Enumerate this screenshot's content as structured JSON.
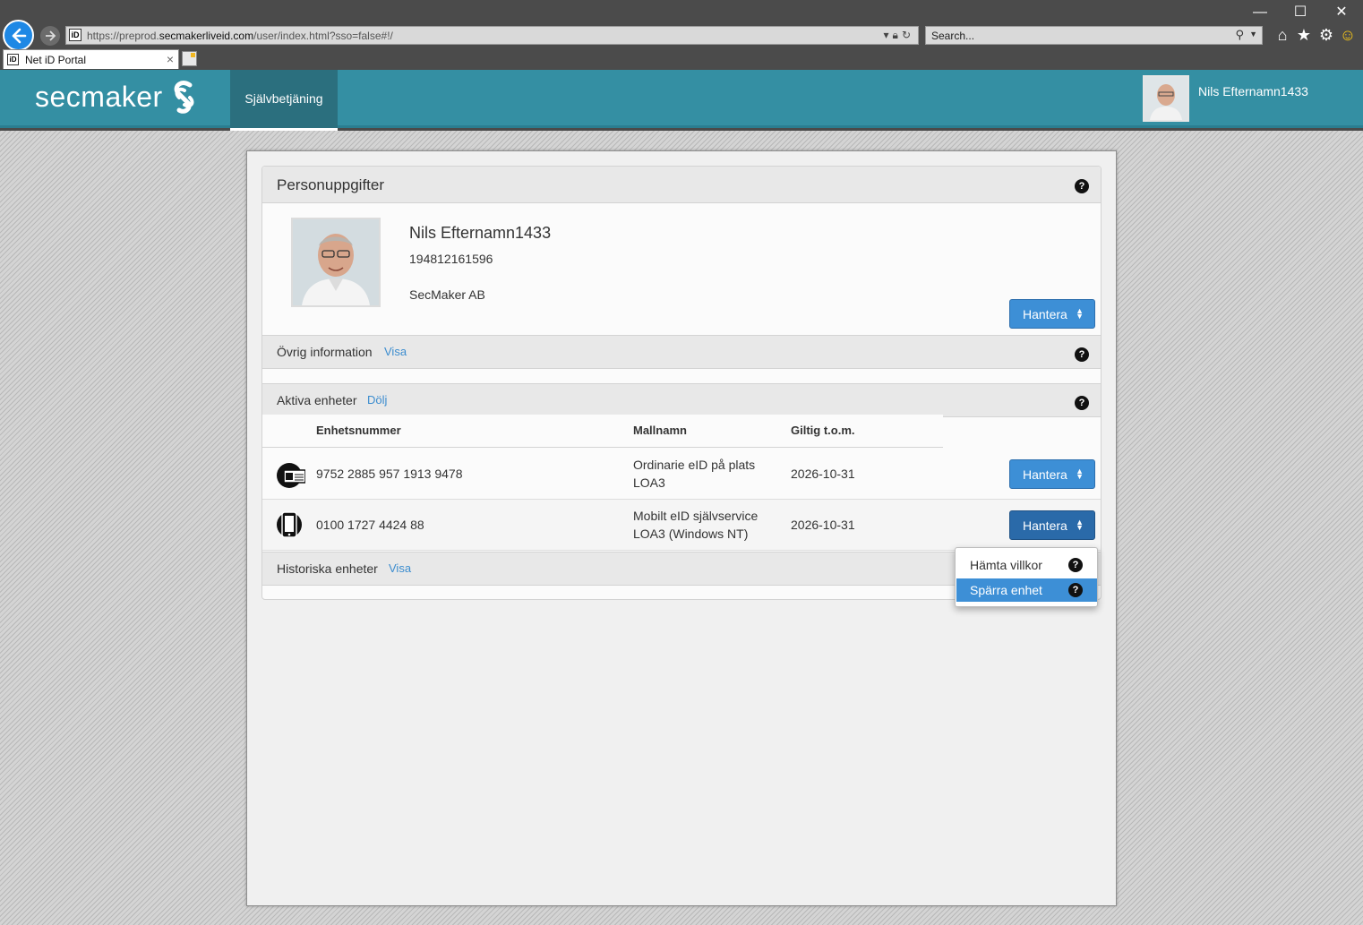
{
  "browser": {
    "url_prefix": "https://",
    "url_sub": "preprod.",
    "url_domain": "secmakerliveid.com",
    "url_path": "/user/index.html?sso=false#!/",
    "site_icon": "iD",
    "search_placeholder": "Search...",
    "tab_title": "Net iD Portal",
    "tab_close": "×",
    "controls": {
      "minimize": "—",
      "maximize": "☐",
      "close": "✕"
    },
    "toolbar_icons": [
      "home-icon",
      "star-icon",
      "gear-icon",
      "smiley-icon"
    ]
  },
  "header": {
    "brand": "secmaker",
    "nav_item": "Självbetjäning",
    "user_name": "Nils Efternamn1433",
    "brand_color": "#348fa3"
  },
  "panel": {
    "title": "Personuppgifter",
    "help": "?",
    "person": {
      "name": "Nils Efternamn1433",
      "id_number": "194812161596",
      "organization": "SecMaker AB"
    },
    "manage_label": "Hantera",
    "other_info": {
      "label": "Övrig information",
      "link": "Visa"
    },
    "active_devices": {
      "label": "Aktiva enheter",
      "link": "Dölj",
      "columns": [
        "Enhetsnummer",
        "Mallnamn",
        "Giltig t.o.m."
      ],
      "rows": [
        {
          "icon": "card-reader-icon",
          "number": "9752 2885 957 1913 9478",
          "template_line1": "Ordinarie eID på plats",
          "template_line2": "LOA3",
          "valid_until": "2026-10-31",
          "action": "Hantera"
        },
        {
          "icon": "mobile-phone-icon",
          "number": "0100 1727 4424 88",
          "template_line1": "Mobilt eID självservice",
          "template_line2": "LOA3 (Windows NT)",
          "valid_until": "2026-10-31",
          "action": "Hantera"
        }
      ]
    },
    "historic_devices": {
      "label": "Historiska enheter",
      "link": "Visa"
    }
  },
  "dropdown": {
    "items": [
      {
        "label": "Hämta villkor",
        "highlighted": false
      },
      {
        "label": "Spärra enhet",
        "highlighted": true
      }
    ]
  }
}
